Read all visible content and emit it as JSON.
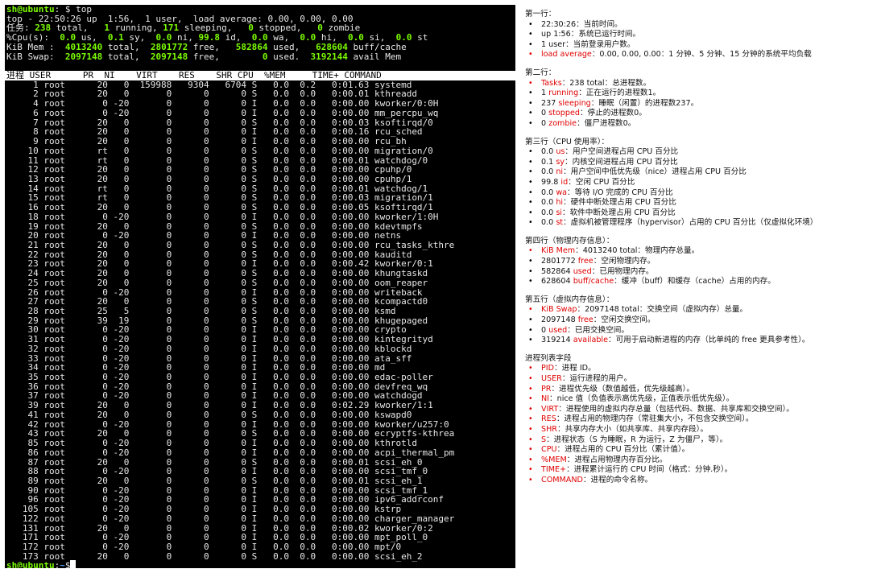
{
  "terminal": {
    "prompt_top": {
      "user": "sh@ubuntu",
      "rest": ": $ top"
    },
    "prompt_bottom": {
      "user": "sh@ubuntu",
      "colon": ":",
      "tilde": "~",
      "dollar": "$"
    },
    "summary": [
      [
        {
          "t": "top - 22:50:26 up  1:56,  1 user,  load average: 0.00, 0.00, 0.00"
        }
      ],
      [
        {
          "t": "任务: "
        },
        {
          "t": "238",
          "c": "g"
        },
        {
          "t": " total,   "
        },
        {
          "t": "1",
          "c": "g"
        },
        {
          "t": " running, "
        },
        {
          "t": "171",
          "c": "g"
        },
        {
          "t": " sleeping,   "
        },
        {
          "t": "0",
          "c": "g"
        },
        {
          "t": " stopped,   "
        },
        {
          "t": "0",
          "c": "g"
        },
        {
          "t": " zombie"
        }
      ],
      [
        {
          "t": "%Cpu(s):  "
        },
        {
          "t": "0.0",
          "c": "g"
        },
        {
          "t": " us,  "
        },
        {
          "t": "0.1",
          "c": "g"
        },
        {
          "t": " sy,  "
        },
        {
          "t": "0.0",
          "c": "g"
        },
        {
          "t": " ni, "
        },
        {
          "t": "99.8",
          "c": "g"
        },
        {
          "t": " id,  "
        },
        {
          "t": "0.0",
          "c": "g"
        },
        {
          "t": " wa,  "
        },
        {
          "t": "0.0",
          "c": "g"
        },
        {
          "t": " hi,  "
        },
        {
          "t": "0.0",
          "c": "g"
        },
        {
          "t": " si,  "
        },
        {
          "t": "0.0",
          "c": "g"
        },
        {
          "t": " st"
        }
      ],
      [
        {
          "t": "KiB Mem :  "
        },
        {
          "t": "4013240",
          "c": "g"
        },
        {
          "t": " total,  "
        },
        {
          "t": "2801772",
          "c": "g"
        },
        {
          "t": " free,   "
        },
        {
          "t": "582864",
          "c": "g"
        },
        {
          "t": " used,   "
        },
        {
          "t": "628604",
          "c": "g"
        },
        {
          "t": " buff/cache"
        }
      ],
      [
        {
          "t": "KiB Swap:  "
        },
        {
          "t": "2097148",
          "c": "g"
        },
        {
          "t": " total,  "
        },
        {
          "t": "2097148",
          "c": "g"
        },
        {
          "t": " free,        "
        },
        {
          "t": "0",
          "c": "g"
        },
        {
          "t": " used.  "
        },
        {
          "t": "3192144",
          "c": "g"
        },
        {
          "t": " avail Mem"
        }
      ]
    ],
    "header": "进程 USER      PR  NI    VIRT    RES    SHR CPU  %MEM     TIME+ COMMAND",
    "processes": [
      "     1 root      20   0  159988   9304   6704 S   0.0  0.2   0:01.63 systemd",
      "     2 root      20   0       0      0      0 S   0.0  0.0   0:00.01 kthreadd",
      "     4 root       0 -20       0      0      0 I   0.0  0.0   0:00.00 kworker/0:0H",
      "     6 root       0 -20       0      0      0 I   0.0  0.0   0:00.00 mm_percpu_wq",
      "     7 root      20   0       0      0      0 S   0.0  0.0   0:00.03 ksoftirqd/0",
      "     8 root      20   0       0      0      0 I   0.0  0.0   0:00.16 rcu_sched",
      "     9 root      20   0       0      0      0 I   0.0  0.0   0:00.00 rcu_bh",
      "    10 root      rt   0       0      0      0 S   0.0  0.0   0:00.00 migration/0",
      "    11 root      rt   0       0      0      0 S   0.0  0.0   0:00.01 watchdog/0",
      "    12 root      20   0       0      0      0 S   0.0  0.0   0:00.00 cpuhp/0",
      "    13 root      20   0       0      0      0 S   0.0  0.0   0:00.00 cpuhp/1",
      "    14 root      rt   0       0      0      0 S   0.0  0.0   0:00.01 watchdog/1",
      "    15 root      rt   0       0      0      0 S   0.0  0.0   0:00.03 migration/1",
      "    16 root      20   0       0      0      0 S   0.0  0.0   0:00.05 ksoftirqd/1",
      "    18 root       0 -20       0      0      0 I   0.0  0.0   0:00.00 kworker/1:0H",
      "    19 root      20   0       0      0      0 S   0.0  0.0   0:00.00 kdevtmpfs",
      "    20 root       0 -20       0      0      0 I   0.0  0.0   0:00.00 netns",
      "    21 root      20   0       0      0      0 S   0.0  0.0   0:00.00 rcu_tasks_kthre",
      "    22 root      20   0       0      0      0 S   0.0  0.0   0:00.00 kauditd",
      "    23 root      20   0       0      0      0 I   0.0  0.0   0:00.42 kworker/0:1",
      "    24 root      20   0       0      0      0 S   0.0  0.0   0:00.00 khungtaskd",
      "    25 root      20   0       0      0      0 S   0.0  0.0   0:00.00 oom_reaper",
      "    26 root       0 -20       0      0      0 I   0.0  0.0   0:00.00 writeback",
      "    27 root      20   0       0      0      0 S   0.0  0.0   0:00.00 kcompactd0",
      "    28 root      25   5       0      0      0 S   0.0  0.0   0:00.00 ksmd",
      "    29 root      39  19       0      0      0 S   0.0  0.0   0:00.00 khugepaged",
      "    30 root       0 -20       0      0      0 I   0.0  0.0   0:00.00 crypto",
      "    31 root       0 -20       0      0      0 I   0.0  0.0   0:00.00 kintegrityd",
      "    32 root       0 -20       0      0      0 I   0.0  0.0   0:00.00 kblockd",
      "    33 root       0 -20       0      0      0 I   0.0  0.0   0:00.00 ata_sff",
      "    34 root       0 -20       0      0      0 I   0.0  0.0   0:00.00 md",
      "    35 root       0 -20       0      0      0 I   0.0  0.0   0:00.00 edac-poller",
      "    36 root       0 -20       0      0      0 I   0.0  0.0   0:00.00 devfreq_wq",
      "    37 root       0 -20       0      0      0 I   0.0  0.0   0:00.00 watchdogd",
      "    39 root      20   0       0      0      0 I   0.0  0.0   0:02.29 kworker/1:1",
      "    41 root      20   0       0      0      0 S   0.0  0.0   0:00.00 kswapd0",
      "    42 root       0 -20       0      0      0 I   0.0  0.0   0:00.00 kworker/u257:0",
      "    43 root      20   0       0      0      0 S   0.0  0.0   0:00.00 ecryptfs-kthrea",
      "    85 root       0 -20       0      0      0 I   0.0  0.0   0:00.00 kthrotld",
      "    86 root       0 -20       0      0      0 I   0.0  0.0   0:00.00 acpi_thermal_pm",
      "    87 root      20   0       0      0      0 S   0.0  0.0   0:00.01 scsi_eh_0",
      "    88 root       0 -20       0      0      0 I   0.0  0.0   0:00.00 scsi_tmf_0",
      "    89 root      20   0       0      0      0 S   0.0  0.0   0:00.01 scsi_eh_1",
      "    90 root       0 -20       0      0      0 I   0.0  0.0   0:00.00 scsi_tmf_1",
      "    96 root       0 -20       0      0      0 I   0.0  0.0   0:00.00 ipv6_addrconf",
      "   105 root       0 -20       0      0      0 I   0.0  0.0   0:00.00 kstrp",
      "   122 root       0 -20       0      0      0 I   0.0  0.0   0:00.00 charger_manager",
      "   131 root      20   0       0      0      0 I   0.0  0.0   0:00.02 kworker/0:2",
      "   171 root       0 -20       0      0      0 I   0.0  0.0   0:00.00 mpt_poll_0",
      "   172 root       0 -20       0      0      0 I   0.0  0.0   0:00.00 mpt/0",
      "   173 root      20   0       0      0      0 S   0.0  0.0   0:00.00 scsi_eh_2"
    ]
  },
  "notes": [
    {
      "title": "第一行：",
      "items": [
        {
          "red": false,
          "kw": "",
          "text": "22:30:26：当前时间。"
        },
        {
          "red": false,
          "kw": "",
          "text": "up 1:56：系统已运行时间。"
        },
        {
          "red": false,
          "kw": "",
          "text": "1 user：当前登录用户数。"
        },
        {
          "red": true,
          "kw": "load average",
          "text": "：0.00, 0.00, 0.00：1 分钟、5 分钟、15 分钟的系统平均负载"
        }
      ]
    },
    {
      "title": "第二行：",
      "items": [
        {
          "red": true,
          "pre": "",
          "kw": "Tasks",
          "text": "：238 total：总进程数。"
        },
        {
          "red": false,
          "pre": "1 ",
          "kw": "running",
          "text": "：正在运行的进程数1。"
        },
        {
          "red": false,
          "pre": "237 ",
          "kw": "sleeping",
          "text": "：睡眠（闲置）的进程数237。"
        },
        {
          "red": false,
          "pre": "0 ",
          "kw": "stopped",
          "text": "：停止的进程数0。"
        },
        {
          "red": false,
          "pre": "0 ",
          "kw": "zombie",
          "text": "：僵尸进程数0。"
        }
      ]
    },
    {
      "title": "第三行（CPU 使用率）：",
      "items": [
        {
          "red": false,
          "pre": "0.0 ",
          "kw": "us",
          "text": "：用户空间进程占用 CPU 百分比"
        },
        {
          "red": false,
          "pre": "0.1 ",
          "kw": "sy",
          "text": "：内核空间进程占用 CPU 百分比"
        },
        {
          "red": false,
          "pre": "0.0 ",
          "kw": "ni",
          "text": "：用户空间中低优先级（nice）进程占用 CPU 百分比"
        },
        {
          "red": false,
          "pre": "99.8 ",
          "kw": "id",
          "text": "：空闲 CPU 百分比"
        },
        {
          "red": false,
          "pre": "0.0 ",
          "kw": "wa",
          "text": "：等待 I/O 完成的 CPU 百分比"
        },
        {
          "red": false,
          "pre": "0.0 ",
          "kw": "hi",
          "text": "：硬件中断处理占用 CPU 百分比"
        },
        {
          "red": false,
          "pre": "0.0 ",
          "kw": "si",
          "text": "：软件中断处理占用 CPU 百分比"
        },
        {
          "red": false,
          "pre": "0.0 ",
          "kw": "st",
          "text": "：虚拟机被管理程序（hypervisor）占用的 CPU 百分比（仅虚拟化环境）"
        }
      ]
    },
    {
      "title": "第四行（物理内存信息）：",
      "items": [
        {
          "red": true,
          "pre": "",
          "kw": "KiB Mem",
          "text": "：4013240 total：物理内存总量。"
        },
        {
          "red": false,
          "pre": "2801772 ",
          "kw": "free",
          "text": "：空闲物理内存。"
        },
        {
          "red": false,
          "pre": "582864 ",
          "kw": "used",
          "text": "：已用物理内存。"
        },
        {
          "red": false,
          "pre": "628604 ",
          "kw": "buff/cache",
          "text": "：缓冲（buff）和缓存（cache）占用的内存。"
        }
      ]
    },
    {
      "title": "第五行（虚拟内存信息）：",
      "items": [
        {
          "red": true,
          "pre": "",
          "kw": "KiB Swap",
          "text": "：2097148 total：交换空间（虚拟内存）总量。"
        },
        {
          "red": false,
          "pre": "2097148 ",
          "kw": "free",
          "text": "：空闲交换空间。"
        },
        {
          "red": false,
          "pre": "0 ",
          "kw": "used",
          "text": "：已用交换空间。"
        },
        {
          "red": false,
          "pre": "319214 ",
          "kw": "available",
          "text": "：可用于启动新进程的内存（比单纯的 free 更具参考性）。"
        }
      ]
    },
    {
      "title": "进程列表字段",
      "items": [
        {
          "red": true,
          "pre": "",
          "kw": "PID",
          "text": "：进程 ID。"
        },
        {
          "red": true,
          "pre": "",
          "kw": "USER",
          "text": "：运行进程的用户。"
        },
        {
          "red": true,
          "pre": "",
          "kw": "PR",
          "text": "：进程优先级（数值越低，优先级越高）。"
        },
        {
          "red": true,
          "pre": "",
          "kw": "NI",
          "text": "：nice 值（负值表示高优先级，正值表示低优先级）。"
        },
        {
          "red": true,
          "pre": "",
          "kw": "VIRT",
          "text": "：进程使用的虚拟内存总量（包括代码、数据、共享库和交换空间）。"
        },
        {
          "red": true,
          "pre": "",
          "kw": "RES",
          "text": "：进程占用的物理内存（常驻集大小，不包含交换空间）。"
        },
        {
          "red": true,
          "pre": "",
          "kw": "SHR",
          "text": "：共享内存大小（如共享库、共享内存段）。"
        },
        {
          "red": true,
          "pre": "",
          "kw": "S",
          "text": "：进程状态（S 为睡眠，R 为运行，Z 为僵尸，等）。"
        },
        {
          "red": true,
          "pre": "",
          "kw": "CPU",
          "text": "：进程占用的 CPU 百分比（累计值）。"
        },
        {
          "red": true,
          "pre": "",
          "kw": "%MEM",
          "text": "：进程占用物理内存百分比。"
        },
        {
          "red": true,
          "pre": "",
          "kw": "TIME+",
          "text": "：进程累计运行的 CPU 时间（格式：分钟.秒）。"
        },
        {
          "red": true,
          "pre": "",
          "kw": "COMMAND",
          "text": "：进程的命令名称。"
        }
      ]
    }
  ]
}
